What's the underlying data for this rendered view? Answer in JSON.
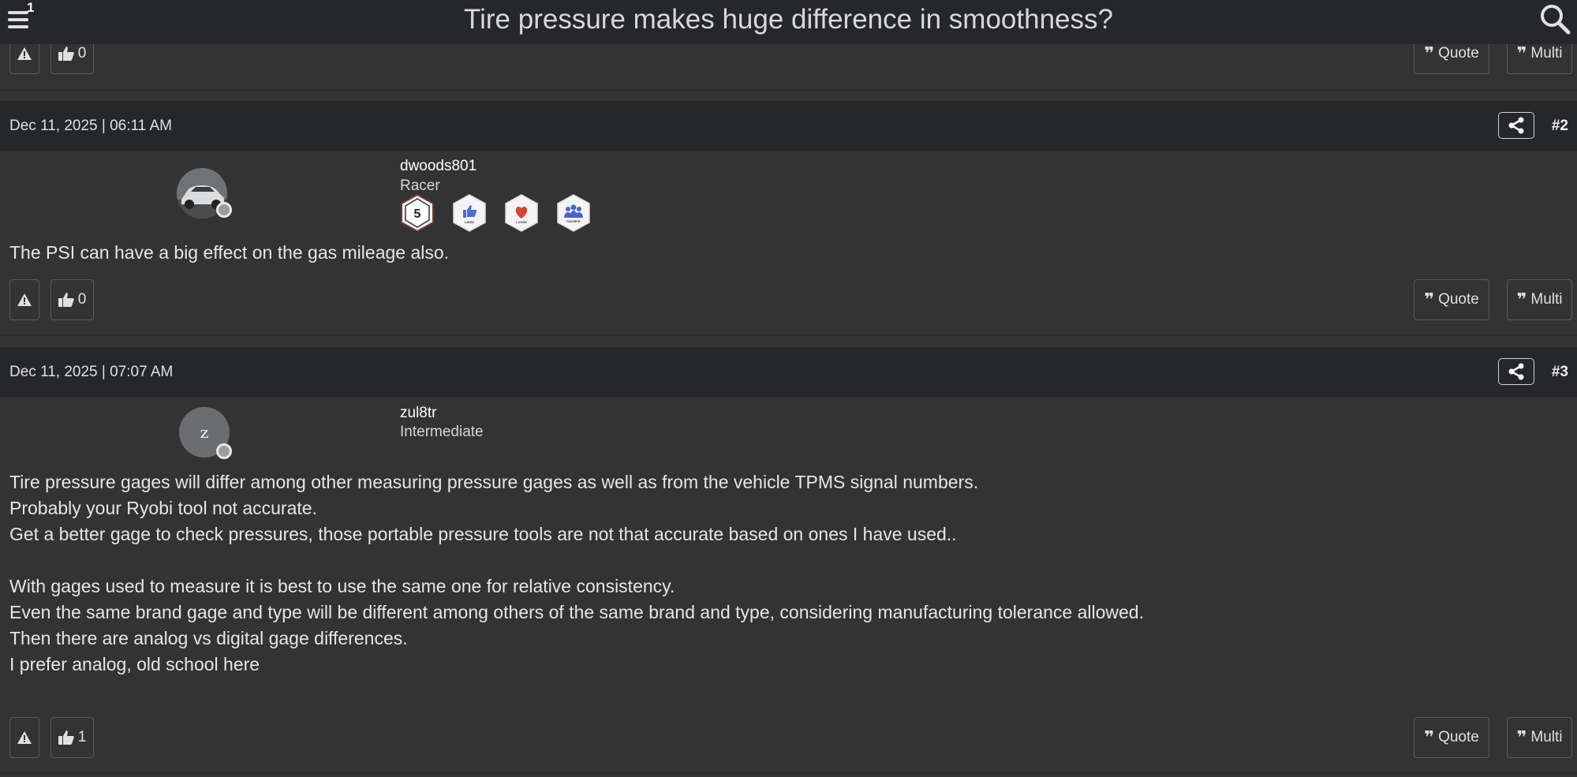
{
  "header": {
    "title": "Tire pressure makes huge difference in smoothness?",
    "menu_badge": "1"
  },
  "top_actions": {
    "like_count": "0",
    "quote_label": "Quote",
    "multi_label": "Multi"
  },
  "posts": [
    {
      "date": "Dec 11, 2025 | 06:11 AM",
      "number": "#2",
      "username": "dwoods801",
      "rank": "Racer",
      "badges": [
        {
          "icon": "5-posts-badge",
          "text": "5"
        },
        {
          "icon": "liked-badge",
          "text": "LIKED"
        },
        {
          "icon": "loved-badge",
          "text": "LOVED"
        },
        {
          "icon": "favorite-badge",
          "text": "FAVORITE"
        }
      ],
      "body": "The PSI can have a big effect on the gas mileage also.",
      "like_count": "0",
      "quote_label": "Quote",
      "multi_label": "Multi"
    },
    {
      "date": "Dec 11, 2025 | 07:07 AM",
      "number": "#3",
      "username": "zul8tr",
      "rank": "Intermediate",
      "avatar_letter": "z",
      "body": "Tire pressure gages will differ among other measuring pressure gages as well as from the vehicle TPMS signal numbers.\nProbably your Ryobi tool not accurate.\nGet a better gage to check pressures, those portable pressure tools are not that accurate based on ones I have used..\n\nWith gages used to measure it is best to use the same one for relative consistency.\nEven the same brand gage and type will be different among others of the same brand and type, considering manufacturing tolerance allowed.\nThen there are analog vs digital gage differences.\nI prefer analog, old school here",
      "like_count": "1",
      "quote_label": "Quote",
      "multi_label": "Multi"
    }
  ],
  "colors": {
    "background": "#333333",
    "header_bar": "#25272a",
    "text": "#e6e6e6",
    "button_border": "#5a5a5a"
  },
  "icons": [
    "menu-icon",
    "search-icon",
    "report-icon",
    "thumbs-up-icon",
    "quote-icon",
    "share-icon"
  ]
}
